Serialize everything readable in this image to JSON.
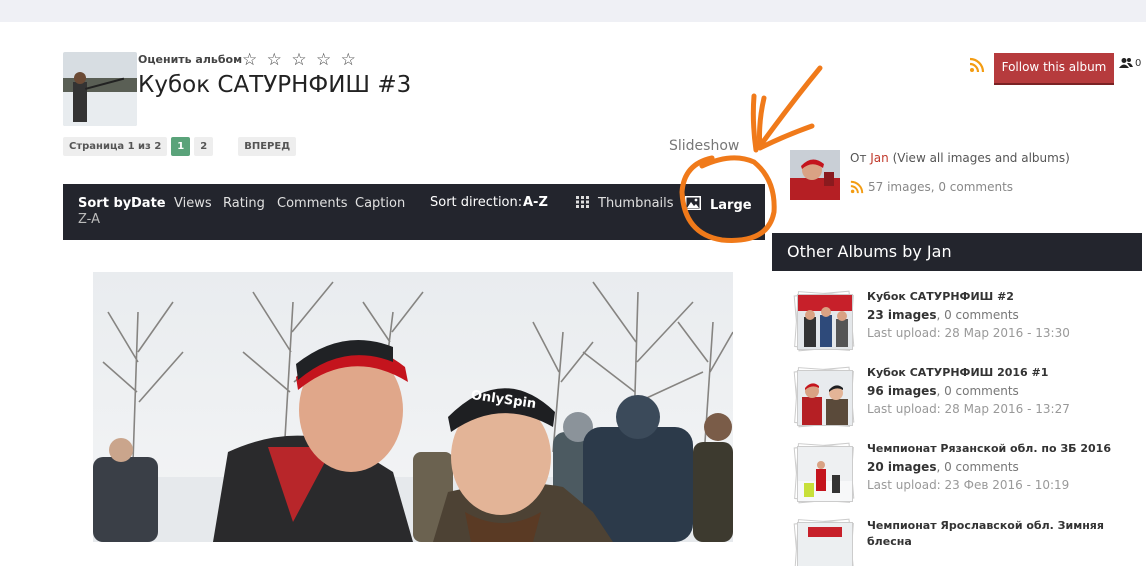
{
  "album": {
    "rate_label": "Оценить альбом",
    "stars": [
      "☆",
      "☆",
      "☆",
      "☆",
      "☆"
    ],
    "title": "Кубок САТУРНФИШ #3"
  },
  "pager": {
    "info": "Страница 1 из 2",
    "pages": [
      "1",
      "2"
    ],
    "next": "ВПЕРЕД"
  },
  "slideshow_label": "Slideshow",
  "toolbar": {
    "sort_by_label": "Sort by:",
    "sort_options": [
      "Date",
      "Views",
      "Rating",
      "Comments",
      "Caption"
    ],
    "active_sort": "Date",
    "sort_dir_label": "Sort direction:",
    "dir_az": "A-Z",
    "dir_za": "Z-A",
    "thumbnails_label": "Thumbnails",
    "large_label": "Large"
  },
  "follow": {
    "button": "Follow this album",
    "count": "0"
  },
  "owner": {
    "by": "От",
    "name": "Jan",
    "view_all": "(View all images and albums)",
    "stats": "57 images, 0 comments"
  },
  "other_albums": {
    "heading": "Other Albums by Jan",
    "items": [
      {
        "title": "Кубок САТУРНФИШ #2",
        "images": "23 images",
        "comments": ", 0 comments",
        "upload": "Last upload: 28 Мар 2016 - 13:30"
      },
      {
        "title": "Кубок САТУРНФИШ 2016 #1",
        "images": "96 images",
        "comments": ", 0 comments",
        "upload": "Last upload: 28 Мар 2016 - 13:27"
      },
      {
        "title": "Чемпионат Рязанской обл. по ЗБ 2016",
        "images": "20 images",
        "comments": ", 0 comments",
        "upload": "Last upload: 23 Фев 2016 - 10:19"
      },
      {
        "title": "Чемпионат Ярославской обл. Зимняя блесна",
        "images": "",
        "comments": "",
        "upload": ""
      }
    ]
  },
  "colors": {
    "toolbar_bg": "#23252d",
    "follow_bg": "#b63b3d",
    "page_active": "#5aa37a",
    "annotation": "#f07a1a",
    "rss": "#f39c12"
  }
}
